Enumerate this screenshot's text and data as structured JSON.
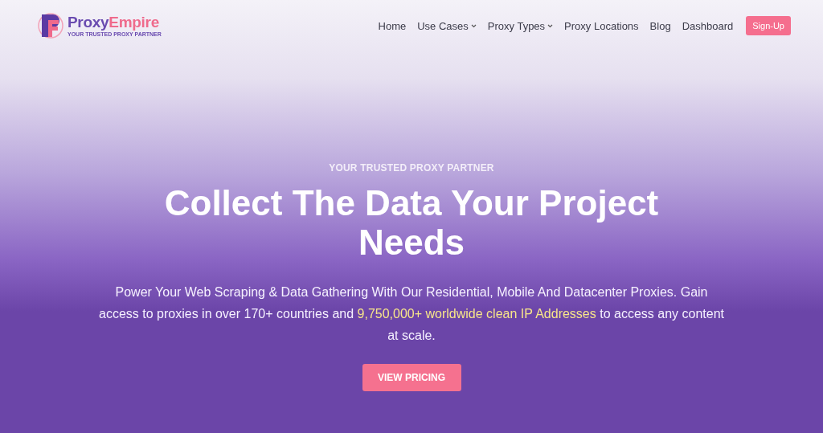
{
  "logo": {
    "name_part1": "Proxy",
    "name_part2": "Empire",
    "tagline": "YOUR TRUSTED PROXY PARTNER"
  },
  "nav": [
    {
      "label": "Home",
      "dropdown": false
    },
    {
      "label": "Use Cases",
      "dropdown": true
    },
    {
      "label": "Proxy Types",
      "dropdown": true
    },
    {
      "label": "Proxy Locations",
      "dropdown": false
    },
    {
      "label": "Blog",
      "dropdown": false
    },
    {
      "label": "Dashboard",
      "dropdown": false
    }
  ],
  "signup": "Sign-Up",
  "hero": {
    "eyebrow": "YOUR TRUSTED PROXY PARTNER",
    "title": "Collect The Data Your Project Needs",
    "description": "Power Your Web Scraping & Data Gathering With Our Residential, Mobile And Datacenter Proxies. Gain access to proxies in over 170+ countries and **9,750,000+ worldwide clean IP Addresses** to access any content at scale.",
    "cta": "VIEW PRICING"
  }
}
